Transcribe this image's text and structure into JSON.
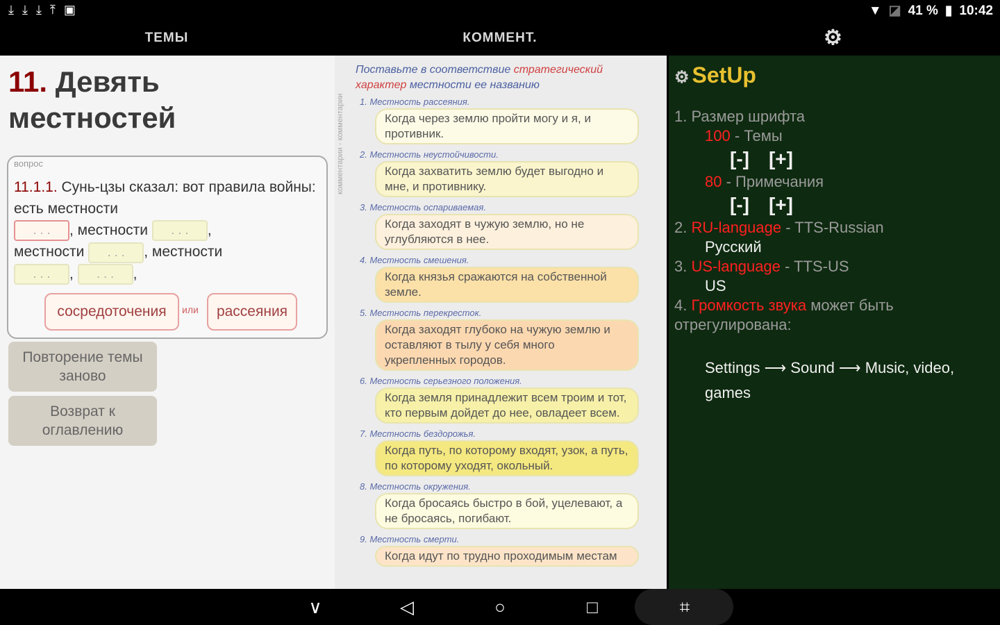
{
  "statusbar": {
    "left_icons": [
      "download-icon",
      "download-icon",
      "download-icon",
      "upload-icon",
      "image-icon"
    ],
    "battery": "41 %",
    "time": "10:42"
  },
  "tabs": {
    "themes": "ТЕМЫ",
    "comment": "КОММЕНТ.",
    "settings_icon": "gear-icon"
  },
  "lesson": {
    "number": "11.",
    "title": "Девять местностей"
  },
  "question": {
    "caption": "вопрос",
    "number": "11.1.1.",
    "text_start": "Сунь-цзы сказал: вот правила войны: есть местности",
    "word_1": ", местности",
    "word_2": "местности",
    "word_3": ", местности",
    "blank": ". . .",
    "option_a": "сосредоточения",
    "or": "или",
    "option_b": "рассеяния"
  },
  "buttons": {
    "repeat": "Повторение темы заново",
    "back": "Возврат к оглавлению"
  },
  "comment": {
    "vertical_caption": "комментарии - комментарии",
    "task_1": "Поставьте в соответствие",
    "task_hl": "стратегический характер",
    "task_2": "местности ее названию",
    "pairs": [
      {
        "label": "1. Местность рассеяния.",
        "text": "Когда через землю пройти могу и я, и противник.",
        "color": "#fdfbe6"
      },
      {
        "label": "2. Местность неустойчивости.",
        "text": "Когда захватить землю будет выгодно и мне, и противнику.",
        "color": "#faf5cc"
      },
      {
        "label": "3. Местность оспариваемая.",
        "text": "Когда заходят в чужую землю, но не углубляются в нее.",
        "color": "#fdf0dc"
      },
      {
        "label": "4. Местность смешения.",
        "text": "Когда князья сражаются на собственной земле.",
        "color": "#fbe0a8"
      },
      {
        "label": "5. Местность перекресток.",
        "text": "Когда заходят глубоко на чужую землю и оставляют в тылу у себя много укрепленных городов.",
        "color": "#fcd8b0"
      },
      {
        "label": "6. Местность серьезного положения.",
        "text": "Когда земля принадлежит всем троим и тот, кто первым дойдет до нее, овладеет всем.",
        "color": "#f6f0a8"
      },
      {
        "label": "7. Местность бездорожья.",
        "text": "Когда путь, по которому входят, узок, а путь, по которому уходят, окольный.",
        "color": "#f4e880"
      },
      {
        "label": "8. Местность окружения.",
        "text": "Когда бросаясь быстро в бой, уцелевают, а не бросаясь, погибают.",
        "color": "#fdfbe0"
      },
      {
        "label": "9. Местность смерти.",
        "text": "Когда идут по трудно проходимым местам",
        "color": "#fde4c8"
      }
    ]
  },
  "setup": {
    "title": "SetUp",
    "item1": "1. Размер шрифта",
    "font_themes_value": "100",
    "font_themes_label": " - Темы",
    "minus": "[-]",
    "plus": "[+]",
    "font_notes_value": "80",
    "font_notes_label": " - Примечания",
    "item2_num": "2.",
    "item2_lang": "RU-language",
    "item2_tts": " - TTS-Russian",
    "item2_value": "Русский",
    "item3_num": "3.",
    "item3_lang": "US-language",
    "item3_tts": " - TTS-US",
    "item3_value": "US",
    "item4_num": "4.",
    "item4_red": "Громкость звука",
    "item4_rest": " может быть отрегулирована:",
    "path_settings": "Settings",
    "path_arrow": "⟶",
    "path_sound": "Sound",
    "path_music": "Music, video, games"
  },
  "navbar": {
    "down": "chevron-down-icon",
    "back": "back-icon",
    "home": "home-icon",
    "recent": "recent-apps-icon",
    "screenshot": "screenshot-icon"
  }
}
